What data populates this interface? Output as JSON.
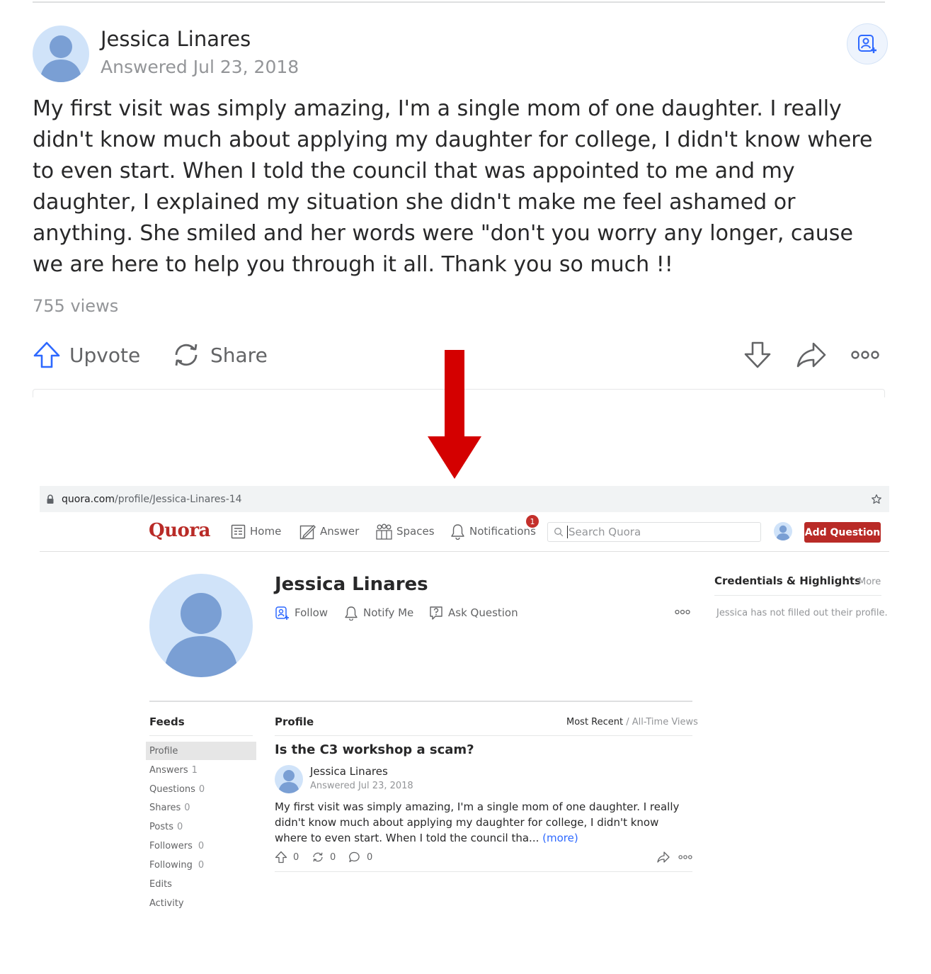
{
  "top_answer": {
    "author": "Jessica Linares",
    "date": "Answered Jul 23, 2018",
    "body": "My first visit was simply amazing, I'm a single mom of one daughter. I really didn't know much about applying my daughter for college, I didn't know where to even start. When I told the council that was appointed to me and my daughter, I explained my situation she didn't make me feel ashamed or anything. She smiled and her words were \"don't you worry any longer, cause we are here to help you through it all. Thank you so much !!",
    "views": "755 views",
    "upvote_label": "Upvote",
    "share_label": "Share"
  },
  "arrow_color": "#d40000",
  "browser": {
    "url_domain": "quora.com",
    "url_path": "/profile/Jessica-Linares-14"
  },
  "nav": {
    "logo": "Quora",
    "home": "Home",
    "answer": "Answer",
    "spaces": "Spaces",
    "notifications": "Notifications",
    "notif_count": "1",
    "search_placeholder": "Search Quora",
    "add_question": "Add Question"
  },
  "profile": {
    "name": "Jessica Linares",
    "follow": "Follow",
    "notify": "Notify Me",
    "ask": "Ask Question"
  },
  "credentials": {
    "title": "Credentials & Highlights",
    "more": "More",
    "empty_text": "Jessica has not filled out their profile."
  },
  "feeds": {
    "title": "Feeds",
    "items": [
      {
        "label": "Profile",
        "count": ""
      },
      {
        "label": "Answers",
        "count": "1"
      },
      {
        "label": "Questions",
        "count": "0"
      },
      {
        "label": "Shares",
        "count": "0"
      },
      {
        "label": "Posts",
        "count": "0"
      },
      {
        "label": "Followers",
        "count": "0"
      },
      {
        "label": "Following",
        "count": "0"
      },
      {
        "label": "Edits",
        "count": ""
      },
      {
        "label": "Activity",
        "count": ""
      }
    ]
  },
  "profile_feed": {
    "title": "Profile",
    "sort_active": "Most Recent",
    "sort_sep": " / ",
    "sort_alt": "All-Time Views",
    "question": "Is the C3 workshop a scam?",
    "answer_author": "Jessica Linares",
    "answer_date": "Answered Jul 23, 2018",
    "answer_excerpt": "My first visit was simply amazing, I'm a single mom of one daughter. I really didn't know much about applying my daughter for college, I didn't know where to even start. When I told the council tha...",
    "more_link": "(more)",
    "upvotes": "0",
    "shares": "0",
    "comments": "0"
  },
  "colors": {
    "brand": "#b92b27",
    "link": "#2e69ff",
    "accent_blue": "#2e69ff"
  }
}
